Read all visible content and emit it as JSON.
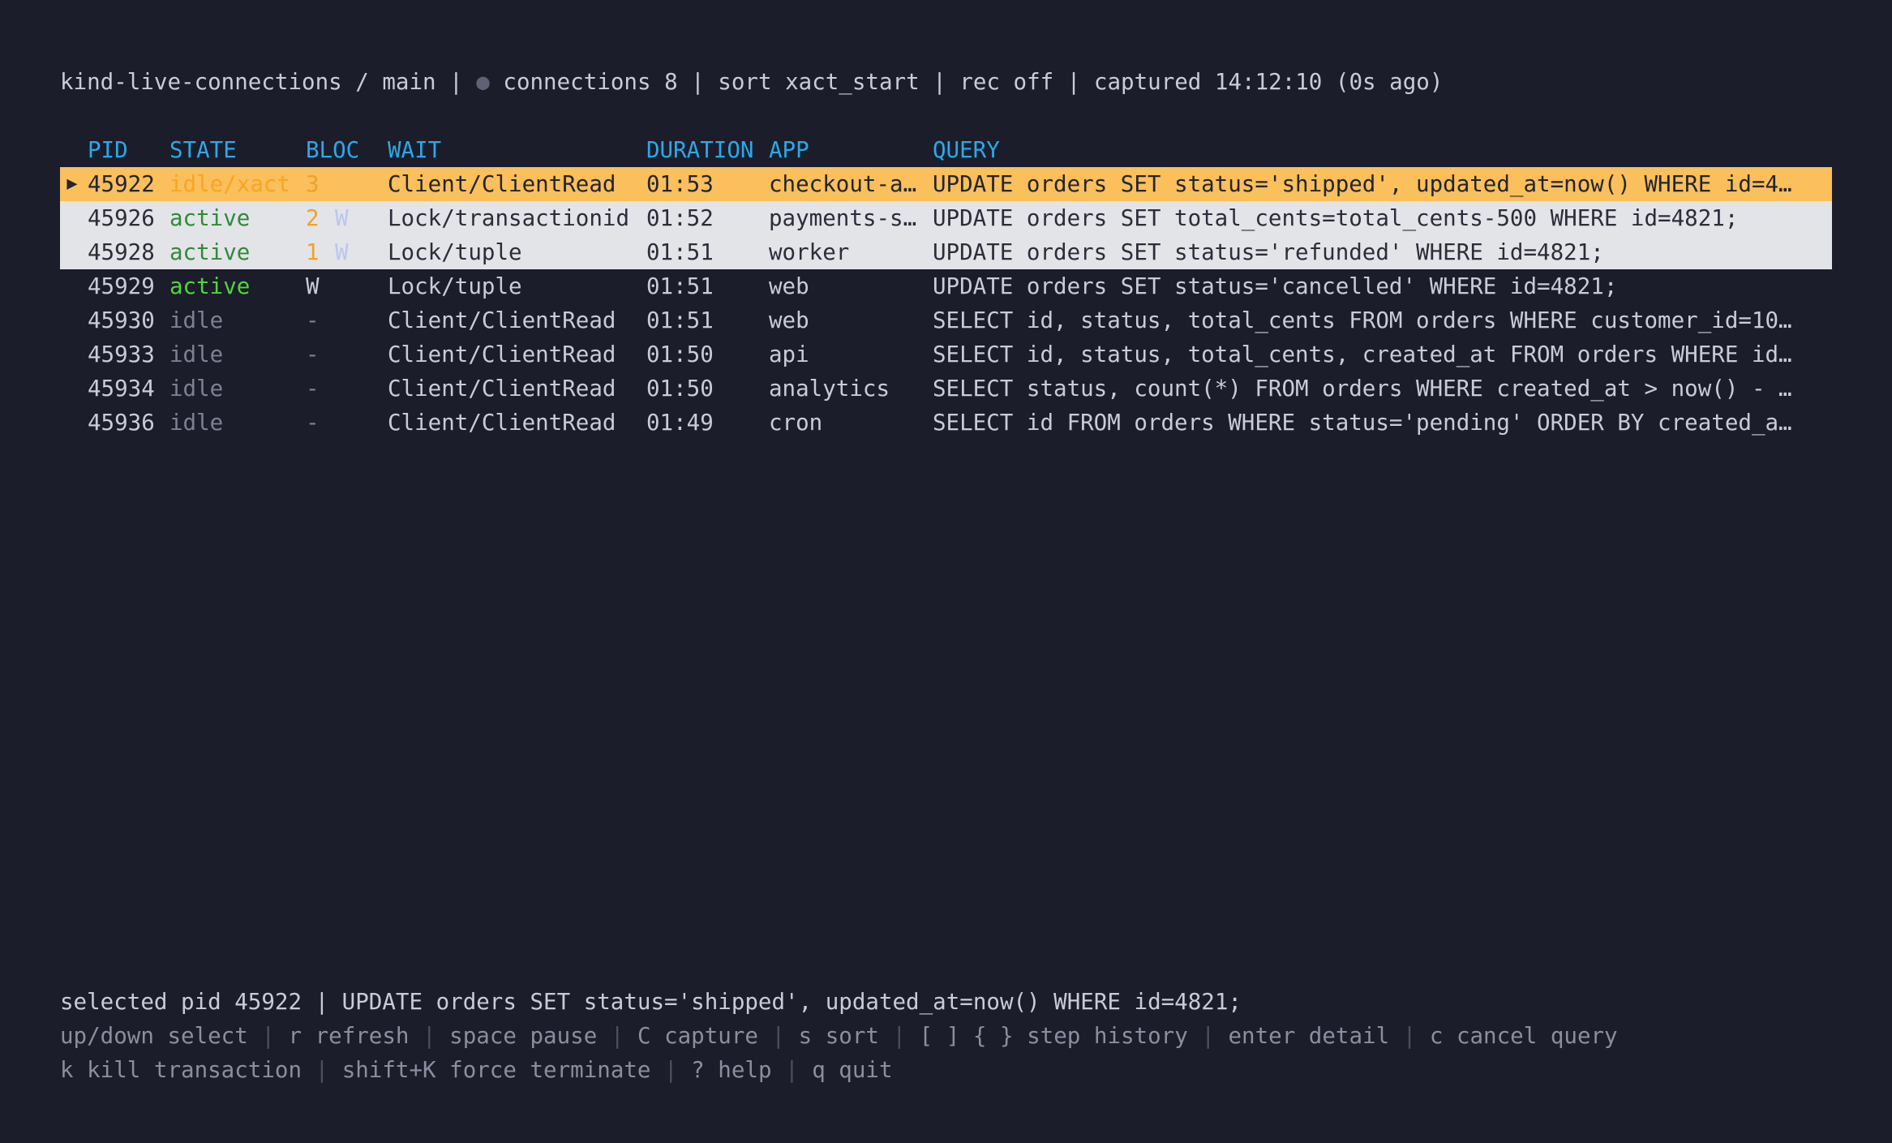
{
  "header": {
    "context": "kind-live-connections / main",
    "connections": "connections 8",
    "sort": "sort xact_start",
    "rec": "rec off",
    "captured": "captured 14:12:10 (0s ago)"
  },
  "columns": {
    "pid": "PID",
    "state": "STATE",
    "block": "BLOCK",
    "wait": "WAIT",
    "duration": "DURATION",
    "app": "APP",
    "query": "QUERY"
  },
  "rows": [
    {
      "marker": "▶",
      "pid": "45922",
      "state": "idle/xact",
      "block": "3",
      "block_w": "",
      "wait": "Client/ClientRead",
      "duration": "01:53",
      "app": "checkout-a…",
      "query": "UPDATE orders SET status='shipped', updated_at=now() WHERE id=4…"
    },
    {
      "marker": "",
      "pid": "45926",
      "state": "active",
      "block": "2",
      "block_w": "W",
      "wait": "Lock/transactionid",
      "duration": "01:52",
      "app": "payments-s…",
      "query": "UPDATE orders SET total_cents=total_cents-500 WHERE id=4821;"
    },
    {
      "marker": "",
      "pid": "45928",
      "state": "active",
      "block": "1",
      "block_w": "W",
      "wait": "Lock/tuple",
      "duration": "01:51",
      "app": "worker",
      "query": "UPDATE orders SET status='refunded' WHERE id=4821;"
    },
    {
      "marker": "",
      "pid": "45929",
      "state": "active",
      "block": "W",
      "block_w": "",
      "wait": "Lock/tuple",
      "duration": "01:51",
      "app": "web",
      "query": "UPDATE orders SET status='cancelled' WHERE id=4821;"
    },
    {
      "marker": "",
      "pid": "45930",
      "state": "idle",
      "block": "-",
      "block_w": "",
      "wait": "Client/ClientRead",
      "duration": "01:51",
      "app": "web",
      "query": "SELECT id, status, total_cents FROM orders WHERE customer_id=10…"
    },
    {
      "marker": "",
      "pid": "45933",
      "state": "idle",
      "block": "-",
      "block_w": "",
      "wait": "Client/ClientRead",
      "duration": "01:50",
      "app": "api",
      "query": "SELECT id, status, total_cents, created_at FROM orders WHERE id…"
    },
    {
      "marker": "",
      "pid": "45934",
      "state": "idle",
      "block": "-",
      "block_w": "",
      "wait": "Client/ClientRead",
      "duration": "01:50",
      "app": "analytics",
      "query": "SELECT status, count(*) FROM orders WHERE created_at > now() - …"
    },
    {
      "marker": "",
      "pid": "45936",
      "state": "idle",
      "block": "-",
      "block_w": "",
      "wait": "Client/ClientRead",
      "duration": "01:49",
      "app": "cron",
      "query": "SELECT id FROM orders WHERE status='pending' ORDER BY created_a…"
    }
  ],
  "footer": {
    "selected": "selected pid 45922 | UPDATE orders SET status='shipped', updated_at=now() WHERE id=4821;",
    "keys_line1": [
      "up/down select",
      "r refresh",
      "space pause",
      "C capture",
      "s sort",
      "[ ] { } step history",
      "enter detail",
      "c cancel query"
    ],
    "keys_line2": [
      "k kill transaction",
      "shift+K force terminate",
      "? help",
      "q quit"
    ]
  }
}
